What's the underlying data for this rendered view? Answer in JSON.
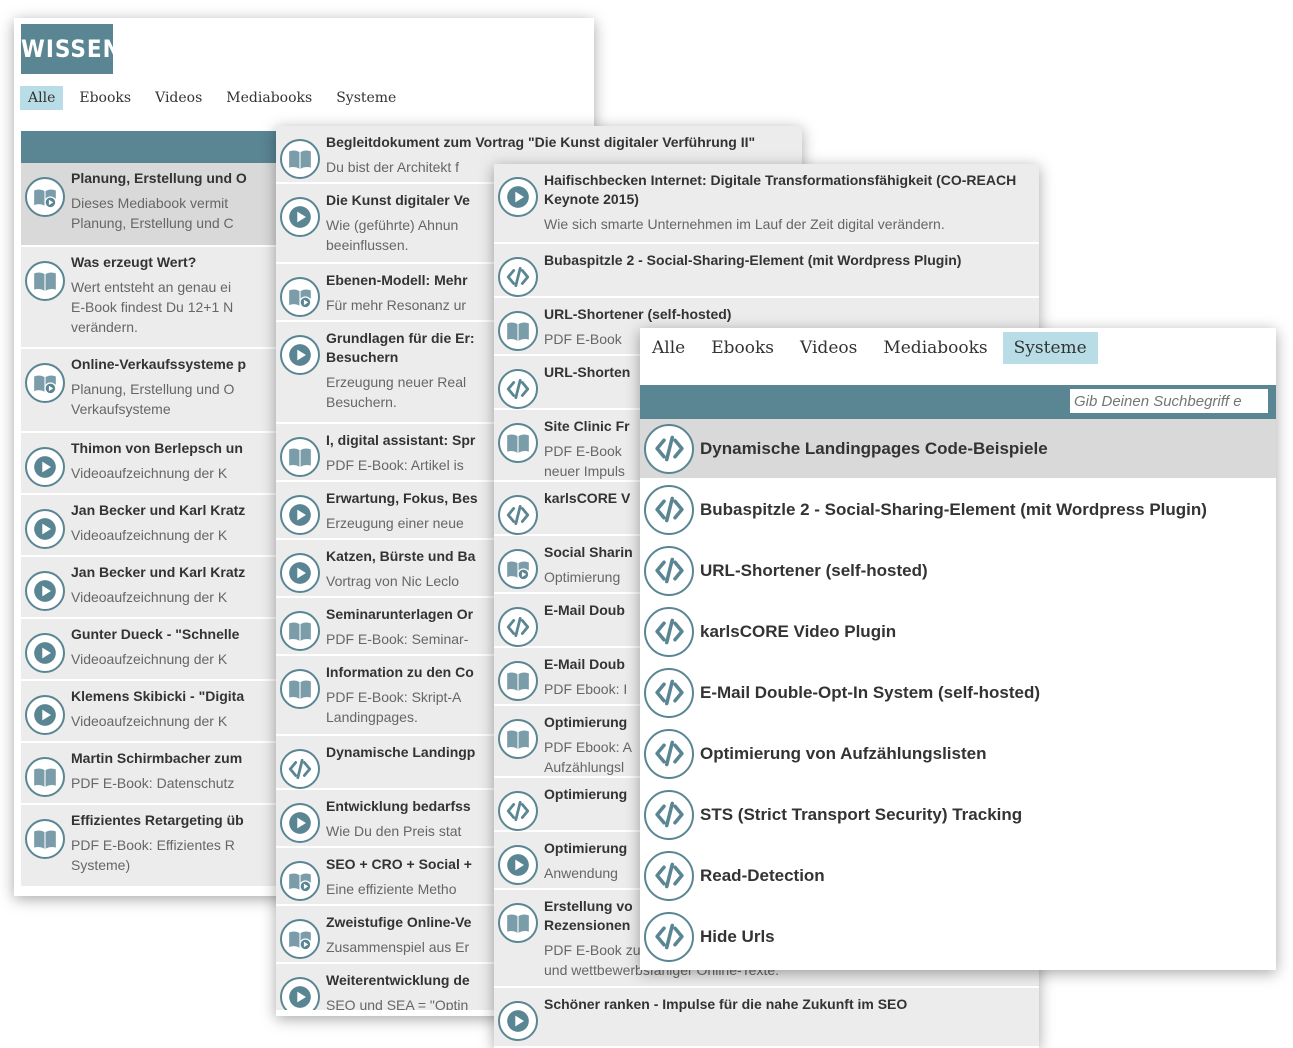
{
  "panel1": {
    "logo": "WISSEN",
    "tabs": [
      "Alle",
      "Ebooks",
      "Videos",
      "Mediabooks",
      "Systeme"
    ],
    "items": [
      {
        "icon": "mediabook-icon",
        "title": "Planung, Erstellung und O",
        "desc": "Dieses Mediabook vermit\nPlanung, Erstellung und C"
      },
      {
        "icon": "book-icon",
        "title": "Was erzeugt Wert?",
        "desc": "Wert entsteht an genau ei\nE-Book findest Du 12+1 N\nverändern."
      },
      {
        "icon": "mediabook-icon",
        "title": "Online-Verkaufssysteme p",
        "desc": "Planung, Erstellung und O\nVerkaufsysteme"
      },
      {
        "icon": "play-icon",
        "title": "Thimon von Berlepsch un",
        "desc": "Videoaufzeichnung der K"
      },
      {
        "icon": "play-icon",
        "title": "Jan Becker und Karl Kratz",
        "desc": "Videoaufzeichnung der K"
      },
      {
        "icon": "play-icon",
        "title": "Jan Becker und Karl Kratz",
        "desc": "Videoaufzeichnung der K"
      },
      {
        "icon": "play-icon",
        "title": "Gunter Dueck - \"Schnelle",
        "desc": "Videoaufzeichnung der K"
      },
      {
        "icon": "play-icon",
        "title": "Klemens Skibicki - \"Digita",
        "desc": "Videoaufzeichnung der K"
      },
      {
        "icon": "book-icon",
        "title": "Martin Schirmbacher zum",
        "desc": "PDF E-Book: Datenschutz"
      },
      {
        "icon": "book-icon",
        "title": "Effizientes Retargeting üb",
        "desc": "PDF E-Book: Effizientes R\nSysteme)"
      }
    ]
  },
  "panel2": {
    "items": [
      {
        "icon": "book-icon",
        "title": "Begleitdokument zum Vortrag \"Die Kunst digitaler Verführung II\"",
        "desc": "Du bist der Architekt f"
      },
      {
        "icon": "play-icon",
        "title": "Die Kunst digitaler Ve",
        "desc": "Wie (geführte) Ahnun\nbeeinflussen."
      },
      {
        "icon": "mediabook-icon",
        "title": "Ebenen-Modell: Mehr",
        "desc": "Für mehr Resonanz ur"
      },
      {
        "icon": "play-icon",
        "title": "Grundlagen für die Er:\nBesuchern",
        "desc": "Erzeugung neuer Real\nBesuchern."
      },
      {
        "icon": "book-icon",
        "title": "I, digital assistant: Spr",
        "desc": "PDF E-Book: Artikel is"
      },
      {
        "icon": "play-icon",
        "title": "Erwartung, Fokus, Bes",
        "desc": "Erzeugung einer neue"
      },
      {
        "icon": "play-icon",
        "title": "Katzen, Bürste und Ba",
        "desc": "Vortrag von Nic Leclo"
      },
      {
        "icon": "book-icon",
        "title": "Seminarunterlagen Or",
        "desc": "PDF E-Book: Seminar-"
      },
      {
        "icon": "book-icon",
        "title": "Information zu den Co",
        "desc": "PDF E-Book: Skript-A\nLandingpages."
      },
      {
        "icon": "code-icon",
        "title": "Dynamische Landingp",
        "desc": ""
      },
      {
        "icon": "play-icon",
        "title": "Entwicklung bedarfss",
        "desc": "Wie Du den Preis stat"
      },
      {
        "icon": "mediabook-icon",
        "title": "SEO + CRO + Social + ",
        "desc": "Eine effiziente Metho"
      },
      {
        "icon": "mediabook-icon",
        "title": "Zweistufige Online-Ve",
        "desc": "Zusammenspiel aus Er"
      },
      {
        "icon": "play-icon",
        "title": "Weiterentwicklung de",
        "desc": "SEO und SEA = \"Optin"
      }
    ]
  },
  "panel3": {
    "items": [
      {
        "icon": "play-icon",
        "title": "Haifischbecken Internet: Digitale Transformationsfähigkeit (CO-REACH\nKeynote 2015)",
        "desc": "Wie sich smarte Unternehmen im Lauf der Zeit digital verändern."
      },
      {
        "icon": "code-icon",
        "title": "Bubaspitzle 2 - Social-Sharing-Element (mit Wordpress Plugin)",
        "desc": ""
      },
      {
        "icon": "book-icon",
        "title": "URL-Shortener (self-hosted)",
        "desc": "PDF E-Book"
      },
      {
        "icon": "code-icon",
        "title": "URL-Shorten",
        "desc": ""
      },
      {
        "icon": "book-icon",
        "title": "Site Clinic Fr",
        "desc": "PDF E-Book\nneuer Impuls"
      },
      {
        "icon": "code-icon",
        "title": "karlsCORE V",
        "desc": ""
      },
      {
        "icon": "mediabook-icon",
        "title": "Social Sharin",
        "desc": "Optimierung"
      },
      {
        "icon": "code-icon",
        "title": "E-Mail Doub",
        "desc": ""
      },
      {
        "icon": "book-icon",
        "title": "E-Mail Doub",
        "desc": "PDF Ebook: I"
      },
      {
        "icon": "book-icon",
        "title": "Optimierung",
        "desc": "PDF Ebook: A\nAufzählungsl"
      },
      {
        "icon": "code-icon",
        "title": "Optimierung",
        "desc": ""
      },
      {
        "icon": "play-icon",
        "title": "Optimierung",
        "desc": "Anwendung"
      },
      {
        "icon": "book-icon",
        "title": "Erstellung vo\nRezensionen",
        "desc": "PDF E-Book zum Ebenen-Modell: Planung und Umsetzung resonanz\nund wettbewerbsfähiger Online-Texte."
      },
      {
        "icon": "play-icon",
        "title": "Schöner ranken - Impulse für die nahe Zukunft im SEO",
        "desc": ""
      }
    ]
  },
  "panel4": {
    "tabs": [
      "Alle",
      "Ebooks",
      "Videos",
      "Mediabooks",
      "Systeme"
    ],
    "active_tab": "Systeme",
    "search_placeholder": "Gib Deinen Suchbegriff e",
    "items": [
      {
        "icon": "code-icon",
        "title": "Dynamische Landingpages Code-Beispiele"
      },
      {
        "icon": "code-icon",
        "title": "Bubaspitzle 2 - Social-Sharing-Element (mit Wordpress Plugin)"
      },
      {
        "icon": "code-icon",
        "title": "URL-Shortener (self-hosted)"
      },
      {
        "icon": "code-icon",
        "title": "karlsCORE Video Plugin"
      },
      {
        "icon": "code-icon",
        "title": "E-Mail Double-Opt-In System (self-hosted)"
      },
      {
        "icon": "code-icon",
        "title": "Optimierung von Aufzählungslisten"
      },
      {
        "icon": "code-icon",
        "title": "STS (Strict Transport Security) Tracking"
      },
      {
        "icon": "code-icon",
        "title": "Read-Detection"
      },
      {
        "icon": "code-icon",
        "title": "Hide Urls"
      }
    ]
  },
  "colors": {
    "accent": "#5a8593",
    "active_tab": "#b9dde6",
    "logo_bg": "#5a8593"
  }
}
